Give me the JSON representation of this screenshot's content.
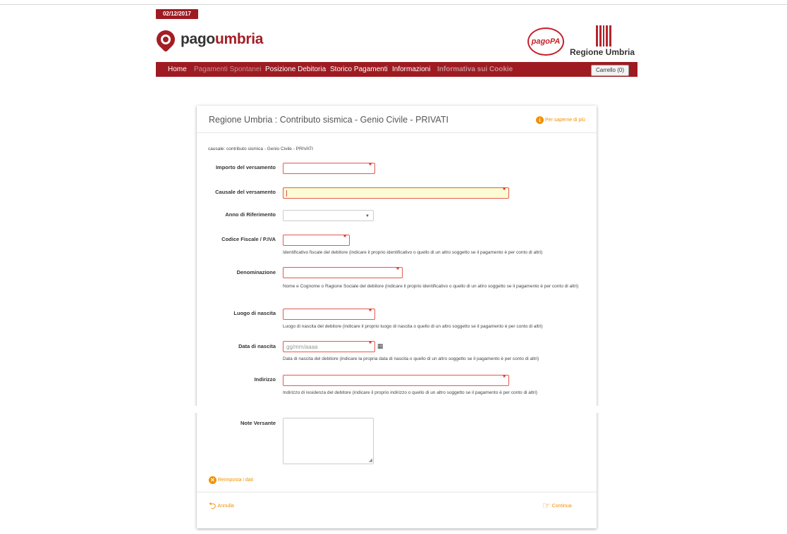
{
  "header": {
    "date": "02/12/2017",
    "logo_part1": "pago",
    "logo_part2": "umbria",
    "pagopa_logo": "pagoPA",
    "regione": "Regione Umbria",
    "cart": "Carrello (0)"
  },
  "nav": {
    "home": "Home",
    "pagamenti_spontanei": "Pagamenti Spontanei",
    "posizione_debitoria": "Posizione Debitoria",
    "storico_pagamenti": "Storico Pagamenti",
    "informazioni": "Informazioni",
    "informativa_cookie": "Informativa sui Cookie"
  },
  "form": {
    "title": "Regione Umbria : Contributo sismica - Genio Civile - PRIVATI",
    "info_link": "Per saperne di più",
    "causale": "causale: contributo sismica - Genio Civile - PRIVATI",
    "importo_label": "Importo del versamento",
    "causale_label": "Causale del versamento",
    "anno_label": "Anno di Riferimento",
    "cf_label": "Codice Fiscale / P.IVA",
    "cf_help": "Identificativo fiscale del debitore (indicare il proprio identificativo o quello di un altro soggetto se il pagamento è per conto di altri)",
    "denominazione_label": "Denominazione",
    "denominazione_help": "Nome e Cognome o Ragione Sociale del debitore (indicare il proprio identificativo o quello di un altro soggetto se il pagamento è per conto di altri)",
    "luogo_label": "Luogo di nascita",
    "luogo_help": "Luogo di nascita del debitore (indicare il proprio luogo di nascita o quello di un altro soggetto se il pagamento è per conto di altri)",
    "data_label": "Data di nascita",
    "data_placeholder": "gg/mm/aaaa",
    "data_help": "Data di nascita del debitore (indicare la propria data di nascita o quello di un altro soggetto se il pagamento è per conto di altri)",
    "indirizzo_label": "Indirizzo",
    "indirizzo_help": "Indirizzo di residenza del debitore (indicare il proprio indirizzo o quello di un altro soggetto se il pagamento è per conto di altri)",
    "note_label": "Note Versante",
    "reset": "Reimposta i dati",
    "annulla": "Annulla",
    "continua": "Continua"
  },
  "icons": {
    "info": "info-icon",
    "reset": "close-circle-icon",
    "annulla": "back-arrow-icon",
    "continua": "pointing-hand-icon",
    "calendar": "calendar-icon"
  },
  "colors": {
    "brand_red": "#9e1b22",
    "accent_orange": "#f29100",
    "error_border": "#e3594f",
    "highlight_field": "#fcfcd4"
  }
}
